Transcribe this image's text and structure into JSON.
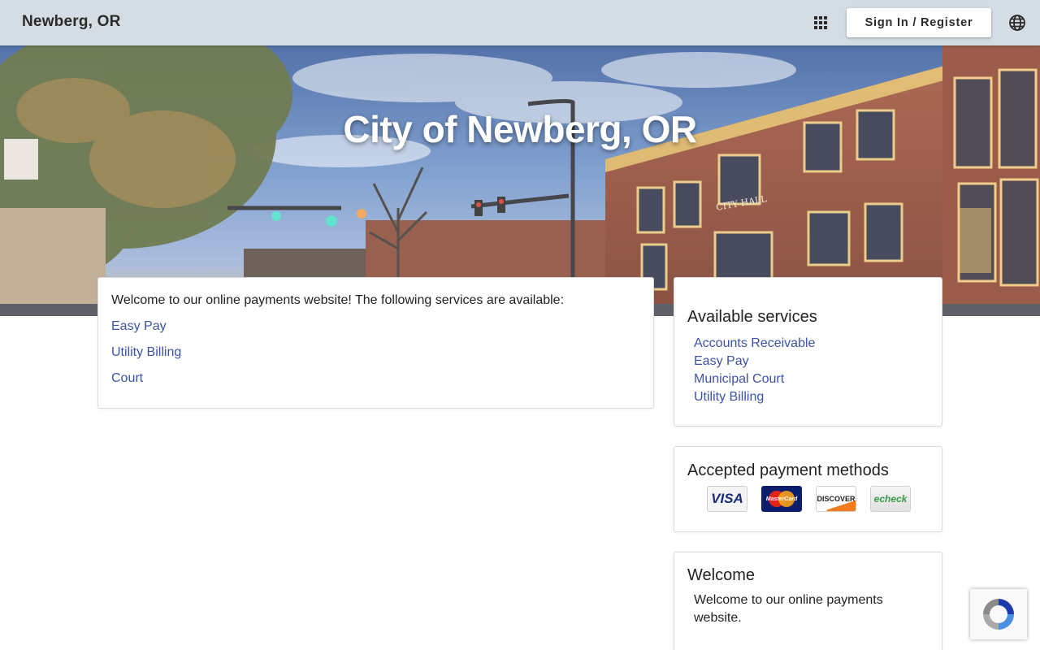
{
  "header": {
    "site_name": "Newberg, OR",
    "sign_in_label": "Sign In / Register"
  },
  "hero": {
    "title": "City of Newberg, OR",
    "building_sign": "CITY HALL"
  },
  "main": {
    "intro": "Welcome to our online payments website! The following services are available:",
    "links": [
      "Easy Pay",
      "Utility Billing",
      "Court"
    ]
  },
  "available_services": {
    "title": "Available services",
    "items": [
      "Accounts Receivable",
      "Easy Pay",
      "Municipal Court",
      "Utility Billing"
    ]
  },
  "payment_methods": {
    "title": "Accepted payment methods",
    "cards": [
      "VISA",
      "MasterCard",
      "DISCOVER",
      "echeck"
    ]
  },
  "welcome": {
    "title": "Welcome",
    "text": "Welcome to our online payments website."
  },
  "colors": {
    "header_bg": "#d3dde3",
    "link": "#3c53a8"
  },
  "icons": [
    "apps-grid-icon",
    "globe-icon",
    "recaptcha-icon"
  ]
}
